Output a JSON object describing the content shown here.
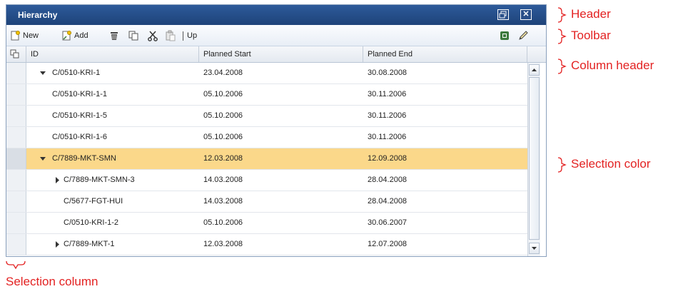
{
  "header": {
    "title": "Hierarchy",
    "restore_icon": "restore-icon",
    "close_icon": "close-icon"
  },
  "toolbar": {
    "new_label": "New",
    "add_label": "Add",
    "up_label": "Up",
    "icons": [
      "new-icon",
      "add-icon",
      "delete-icon",
      "copy-icon",
      "cut-icon",
      "paste-icon",
      "export-icon",
      "edit-icon"
    ]
  },
  "columns": {
    "id": "ID",
    "start": "Planned Start",
    "end": "Planned End"
  },
  "rows": [
    {
      "id": "C/0510-KRI-1",
      "start": "23.04.2008",
      "end": "30.08.2008",
      "expand": "expanded"
    },
    {
      "id": "C/0510-KRI-1-1",
      "start": "05.10.2006",
      "end": "30.11.2006",
      "expand": "none"
    },
    {
      "id": "C/0510-KRI-1-5",
      "start": "05.10.2006",
      "end": "30.11.2006",
      "expand": "none"
    },
    {
      "id": "C/0510-KRI-1-6",
      "start": "05.10.2006",
      "end": "30.11.2006",
      "expand": "none"
    },
    {
      "id": "C/7889-MKT-SMN",
      "start": "12.03.2008",
      "end": "12.09.2008",
      "expand": "expanded",
      "selected": true
    },
    {
      "id": "C/7889-MKT-SMN-3",
      "start": "14.03.2008",
      "end": "28.04.2008",
      "expand": "collapsed"
    },
    {
      "id": "C/5677-FGT-HUI",
      "start": "14.03.2008",
      "end": "28.04.2008",
      "expand": "none"
    },
    {
      "id": "C/0510-KRI-1-2",
      "start": "05.10.2006",
      "end": "30.06.2007",
      "expand": "none"
    },
    {
      "id": "C/7889-MKT-1",
      "start": "12.03.2008",
      "end": "12.07.2008",
      "expand": "collapsed"
    }
  ],
  "colors": {
    "header": "#1e4379",
    "selection": "#fbd88a",
    "annotation": "#e32222"
  },
  "annotations": {
    "header": "Header",
    "toolbar": "Toolbar",
    "column_header": "Column header",
    "selection_color": "Selection color",
    "selection_column": "Selection column"
  }
}
